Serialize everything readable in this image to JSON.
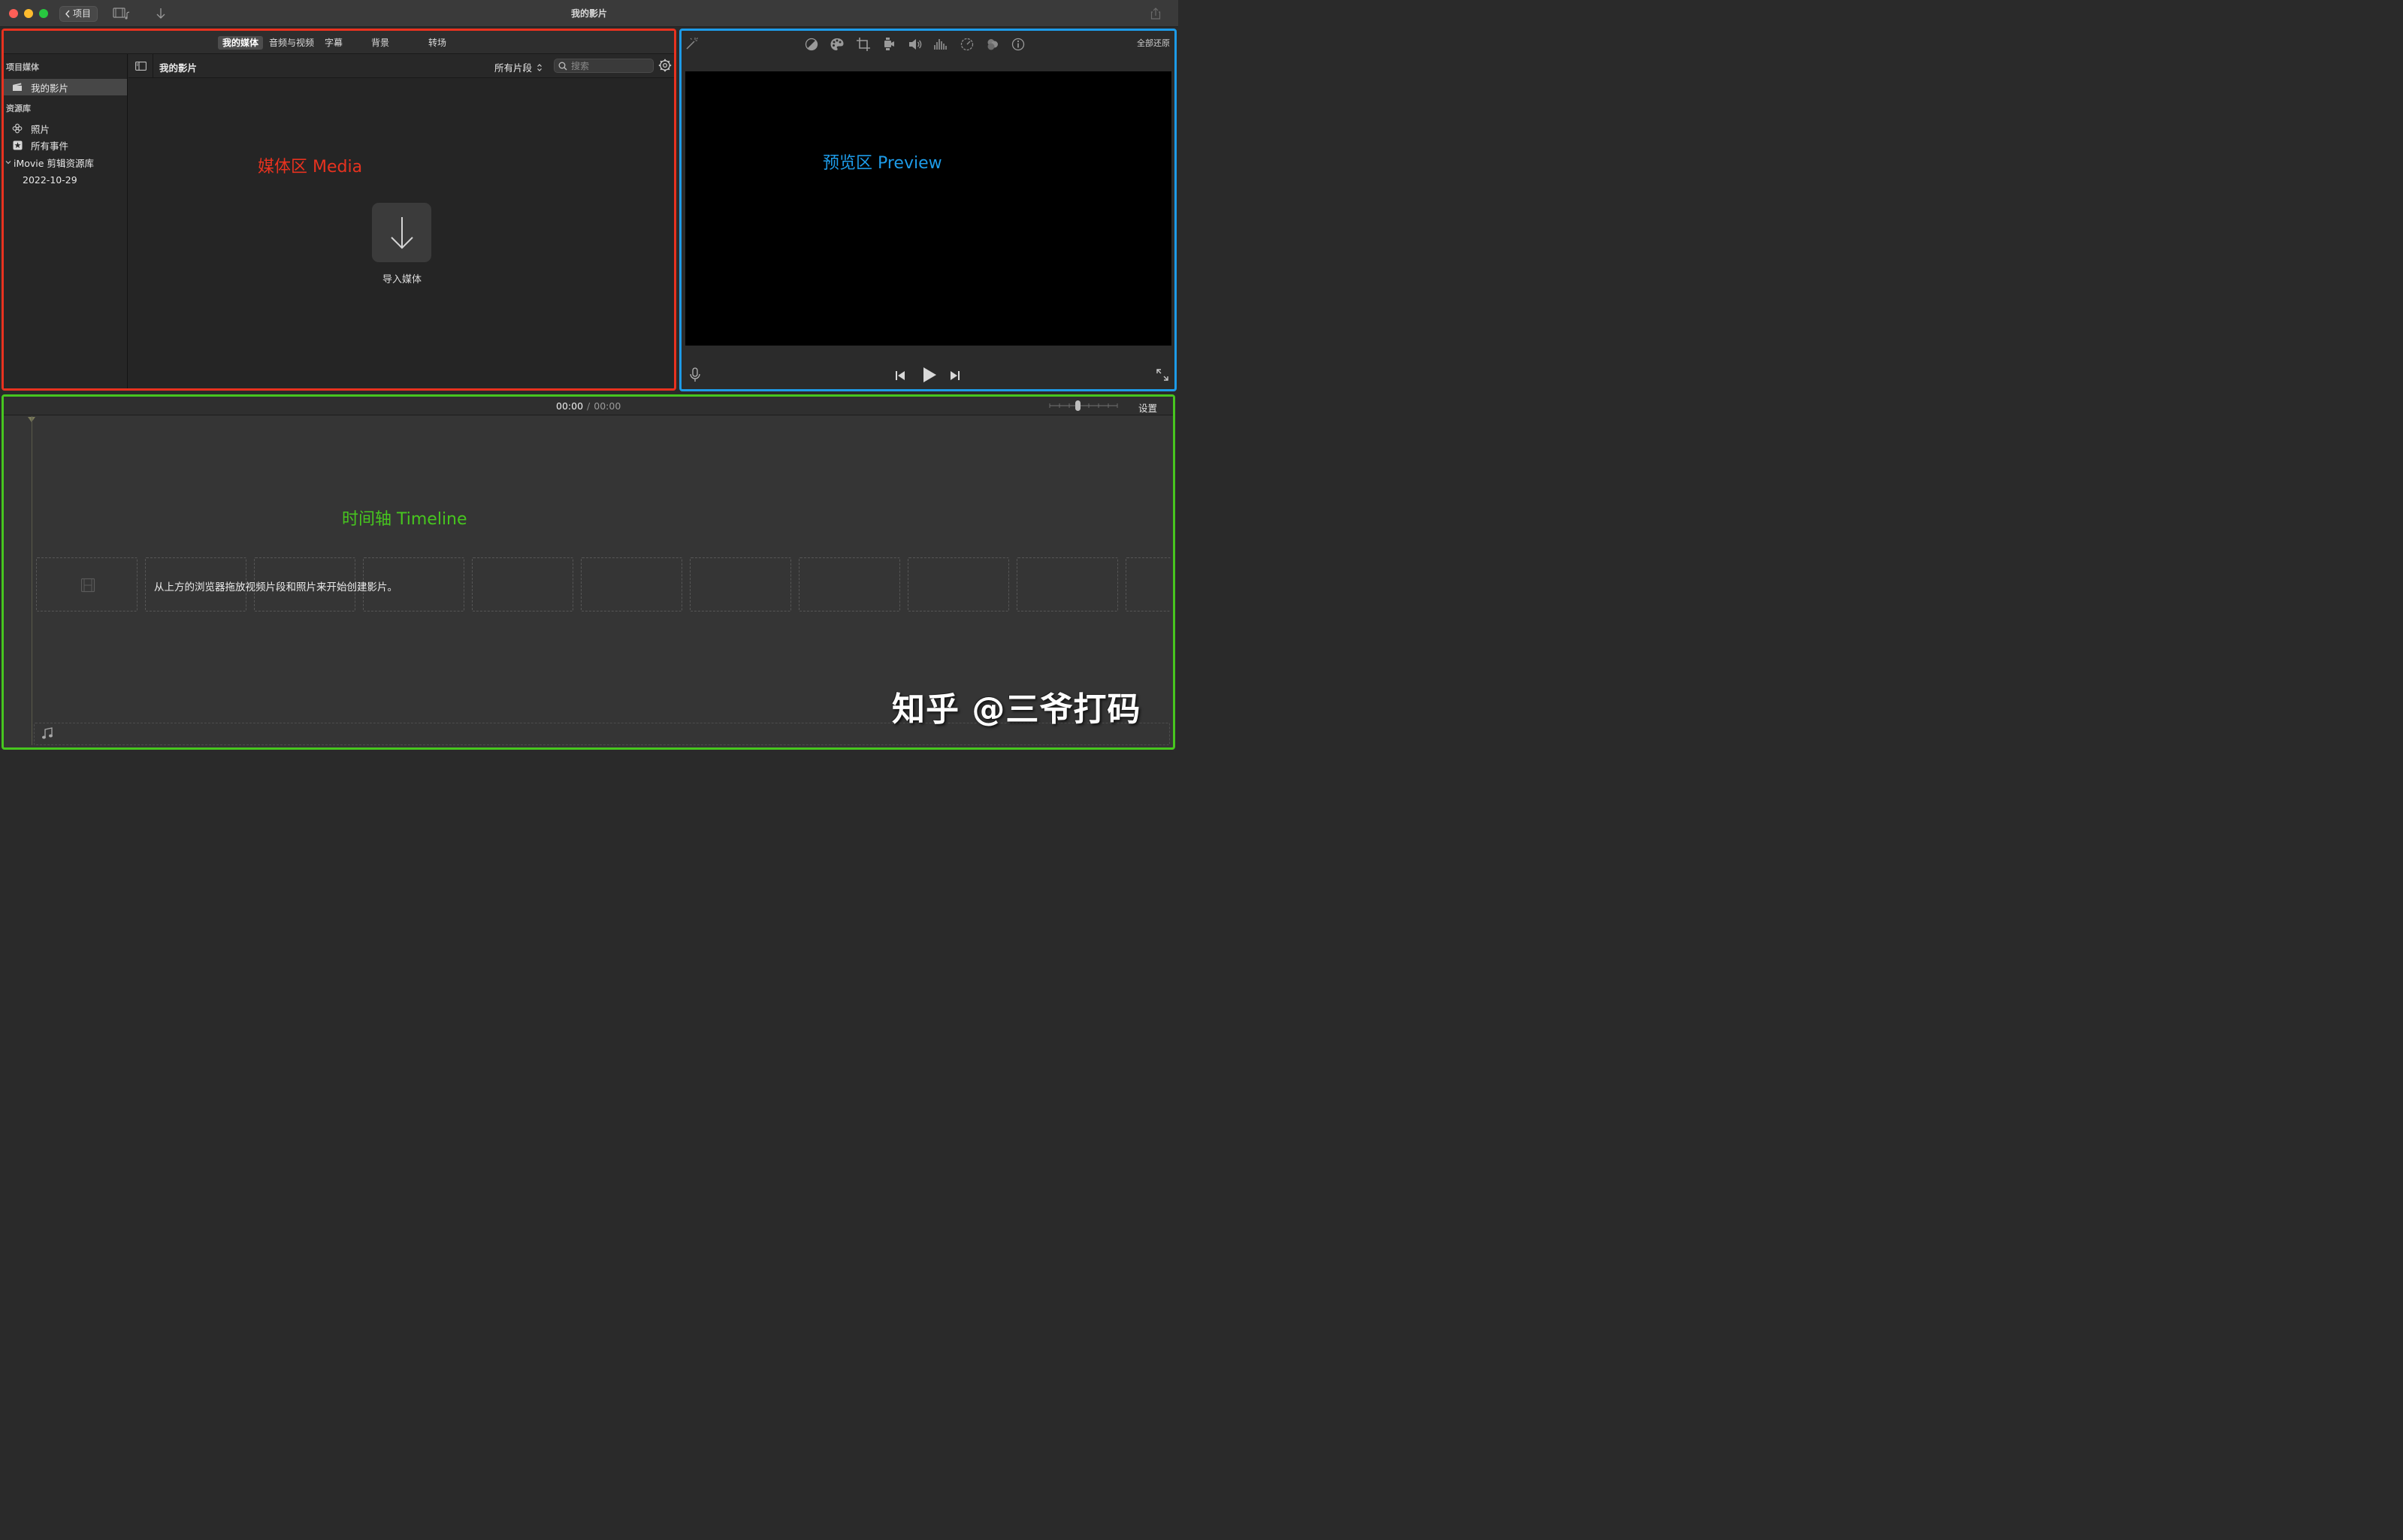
{
  "window": {
    "title": "我的影片",
    "back_label": "项目",
    "icons": [
      "film-music-icon",
      "import-arrow-icon",
      "share-icon"
    ]
  },
  "media": {
    "annotation": "媒体区 Media",
    "annotation_color": "#e8321f",
    "tabs": [
      {
        "label": "我的媒体",
        "active": true
      },
      {
        "label": "音频与视频",
        "active": false
      },
      {
        "label": "字幕",
        "active": false
      },
      {
        "label": "背景",
        "active": false
      },
      {
        "label": "转场",
        "active": false
      }
    ],
    "sidebar": {
      "project_section": "项目媒体",
      "project_item": "我的影片",
      "library_section": "资源库",
      "items": [
        "照片",
        "所有事件"
      ],
      "library_name": "iMovie 剪辑资源库",
      "event_date": "2022-10-29"
    },
    "browser": {
      "title": "我的影片",
      "filter": "所有片段",
      "search_placeholder": "搜索"
    },
    "import_label": "导入媒体"
  },
  "preview": {
    "annotation": "预览区 Preview",
    "annotation_color": "#1d9be8",
    "reset_label": "全部还原",
    "toolbar_icons": [
      "magic-wand-icon",
      "color-balance-icon",
      "color-palette-icon",
      "crop-icon",
      "stabilization-icon",
      "volume-icon",
      "equalizer-icon",
      "speed-icon",
      "clip-filter-icon",
      "info-icon"
    ]
  },
  "timeline": {
    "annotation": "时间轴 Timeline",
    "annotation_color": "#47c61f",
    "current_time": "00:00",
    "separator": "/",
    "total_time": "00:00",
    "settings_label": "设置",
    "drop_hint": "从上方的浏览器拖放视频片段和照片来开始创建影片。"
  },
  "watermark": "知乎 @三爷打码"
}
